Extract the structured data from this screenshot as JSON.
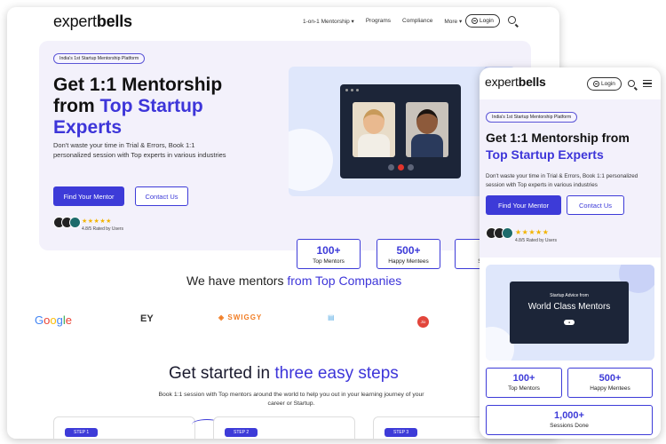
{
  "desktop": {
    "logo": {
      "a": "expert",
      "b": "bells"
    },
    "nav": {
      "items": [
        "1-on-1 Mentorship",
        "Programs",
        "Compliance",
        "More"
      ],
      "login": "Login"
    },
    "hero": {
      "badge": "India's 1st Startup Mentorship Platform",
      "title_line1": "Get 1:1 Mentorship",
      "title_from": "from ",
      "title_blue1": "Top Startup",
      "title_blue2": "Experts",
      "description": "Don't waste your time in Trial & Errors, Book 1:1 personalized session with Top experts in various industries",
      "find_mentor": "Find Your Mentor",
      "contact_us": "Contact Us",
      "stars": "★★★★★",
      "rating": "4.8/5 Rated by Users"
    },
    "stats": [
      {
        "value": "100+",
        "label": "Top Mentors"
      },
      {
        "value": "500+",
        "label": "Happy Mentees"
      },
      {
        "value": "1,0",
        "label": "Sessio"
      }
    ],
    "companies": {
      "title_plain": "We have mentors ",
      "title_blue": "from Top Companies",
      "logos": [
        "Google",
        "EY",
        "SWIGGY",
        "Jio"
      ]
    },
    "steps": {
      "title_plain": "Get started in ",
      "title_blue": "three easy steps",
      "description": "Book 1:1 session with Top mentors around the world to help you out in your learning journey of your career or Startup.",
      "cards": [
        "STEP 1",
        "STEP 2",
        "STEP 3"
      ]
    }
  },
  "mobile": {
    "logo": {
      "a": "expert",
      "b": "bells"
    },
    "login": "Login",
    "hero": {
      "badge": "India's 1st Startup Mentorship Platform",
      "title_line1": "Get 1:1 Mentorship from",
      "title_blue": "Top Startup Experts",
      "description": "Don't waste your time in Trial & Errors, Book 1:1 personalized session with Top experts in various industries",
      "find_mentor": "Find Your Mentor",
      "contact_us": "Contact Us",
      "stars": "★★★★★",
      "rating": "4.8/5 Rated by Users"
    },
    "image": {
      "small": "Startup Advice from",
      "big": "World Class Mentors"
    },
    "stats": [
      {
        "value": "100+",
        "label": "Top Mentors"
      },
      {
        "value": "500+",
        "label": "Happy Mentees"
      },
      {
        "value": "1,000+",
        "label": "Sessions Done"
      }
    ]
  },
  "colors": {
    "accent": "#3d3bd8",
    "hero_bg": "#f3f1fb",
    "stars": "#f2b400"
  }
}
